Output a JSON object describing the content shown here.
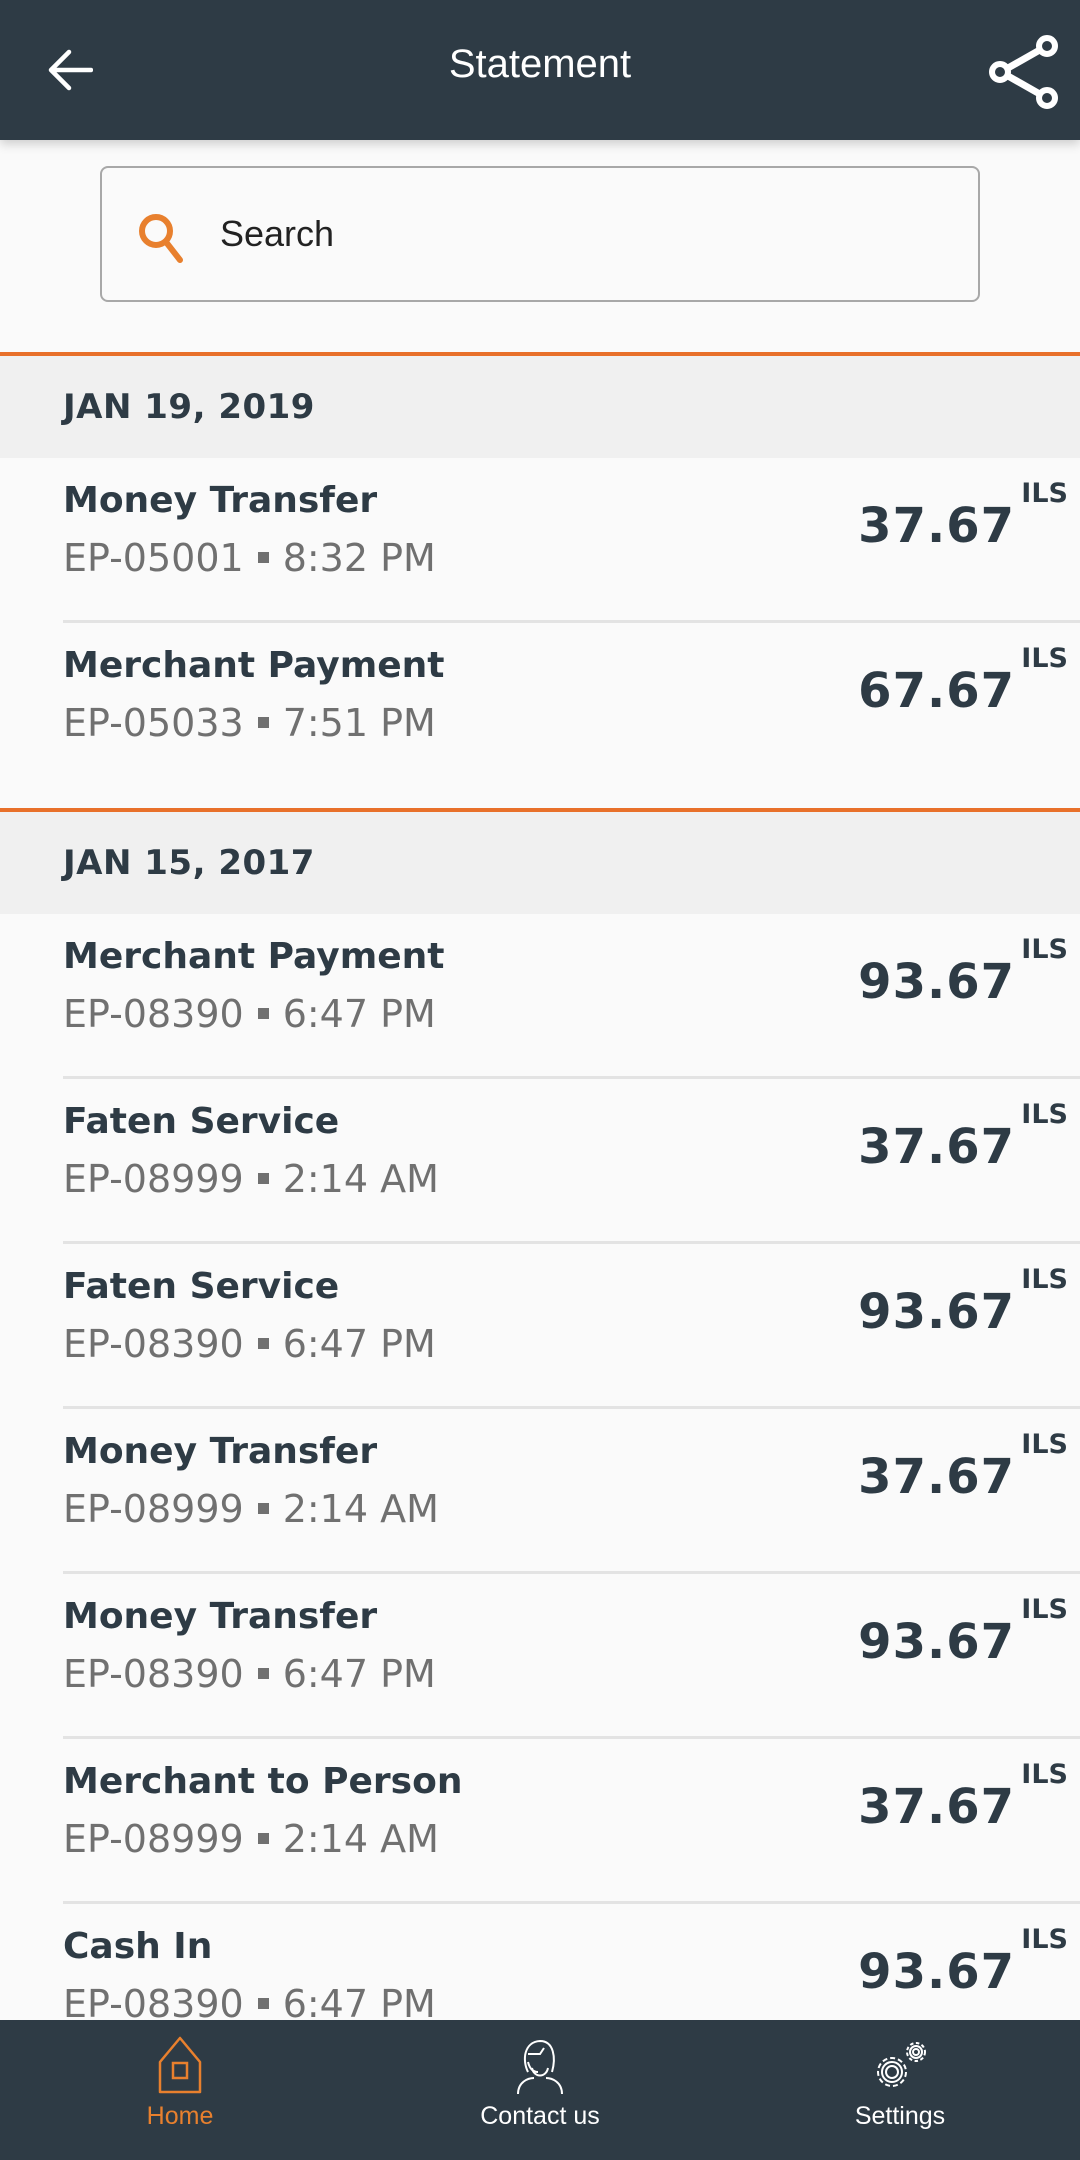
{
  "header": {
    "title": "Statement",
    "back_icon": "arrow-left-icon",
    "share_icon": "share-icon"
  },
  "search": {
    "placeholder": "Search",
    "value": "",
    "icon": "search-icon"
  },
  "colors": {
    "header_bg": "#2e3b45",
    "accent": "#e8702a",
    "text_primary": "#2e3b45",
    "text_secondary": "#707070"
  },
  "groups": [
    {
      "date": "JAN 19, 2019",
      "transactions": [
        {
          "name": "Money Transfer",
          "ref": "EP-05001",
          "time": "8:32 PM",
          "amount": "37.67",
          "currency": "ILS"
        },
        {
          "name": "Merchant Payment",
          "ref": "EP-05033",
          "time": "7:51 PM",
          "amount": "67.67",
          "currency": "ILS"
        }
      ]
    },
    {
      "date": "JAN 15, 2017",
      "transactions": [
        {
          "name": "Merchant Payment",
          "ref": "EP-08390",
          "time": "6:47 PM",
          "amount": "93.67",
          "currency": "ILS"
        },
        {
          "name": "Faten Service",
          "ref": "EP-08999",
          "time": "2:14 AM",
          "amount": "37.67",
          "currency": "ILS"
        },
        {
          "name": "Faten Service",
          "ref": "EP-08390",
          "time": "6:47 PM",
          "amount": "93.67",
          "currency": "ILS"
        },
        {
          "name": "Money Transfer",
          "ref": "EP-08999",
          "time": "2:14 AM",
          "amount": "37.67",
          "currency": "ILS"
        },
        {
          "name": "Money Transfer",
          "ref": "EP-08390",
          "time": "6:47 PM",
          "amount": "93.67",
          "currency": "ILS"
        },
        {
          "name": "Merchant to Person",
          "ref": "EP-08999",
          "time": "2:14 AM",
          "amount": "37.67",
          "currency": "ILS"
        },
        {
          "name": "Cash In",
          "ref": "EP-08390",
          "time": "6:47 PM",
          "amount": "93.67",
          "currency": "ILS"
        }
      ]
    }
  ],
  "bottom_nav": {
    "items": [
      {
        "label": "Home",
        "icon": "home-icon",
        "active": true
      },
      {
        "label": "Contact us",
        "icon": "support-agent-icon",
        "active": false
      },
      {
        "label": "Settings",
        "icon": "gears-icon",
        "active": false
      }
    ]
  }
}
